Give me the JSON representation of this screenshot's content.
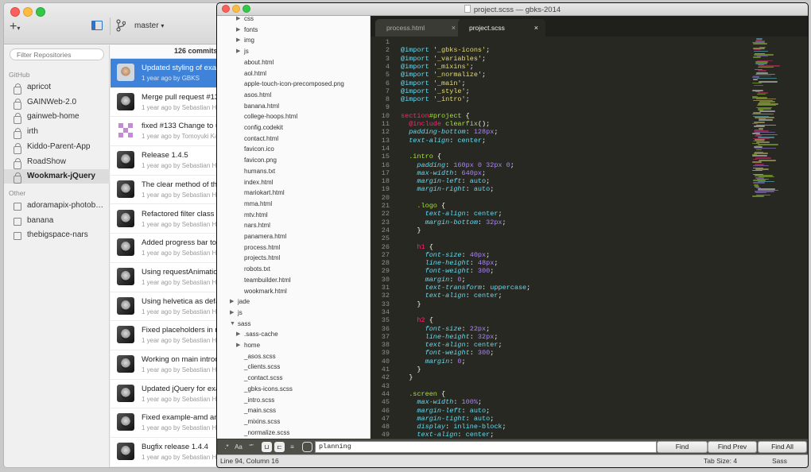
{
  "github": {
    "add_label": "+",
    "branch": "master",
    "filter_placeholder": "Filter Repositories",
    "commit_count": "126 commits",
    "sections": [
      {
        "label": "GitHub",
        "repos": [
          "apricot",
          "GAINWeb-2.0",
          "gainweb-home",
          "irth",
          "Kiddo-Parent-App",
          "RoadShow",
          "Wookmark-jQuery"
        ]
      },
      {
        "label": "Other",
        "repos": [
          "adoramapix-photob…",
          "banana",
          "thebigspace-nars"
        ]
      }
    ],
    "selected_repo": "Wookmark-jQuery",
    "commits": [
      {
        "title": "Updated styling of examp",
        "meta": "1 year ago by GBKS",
        "selected": true,
        "avatar": "photo"
      },
      {
        "title": "Merge pull request #134",
        "meta": "1 year ago by Sebastian Helz",
        "avatar": "bw"
      },
      {
        "title": "fixed #133 Change to us",
        "meta": "1 year ago by Tomoyuki Kaku",
        "avatar": "pix"
      },
      {
        "title": "Release 1.4.5",
        "meta": "1 year ago by Sebastian Helz",
        "avatar": "bw"
      },
      {
        "title": "The clear method of the",
        "meta": "1 year ago by Sebastian Helz",
        "avatar": "bw"
      },
      {
        "title": "Refactored filter class ha",
        "meta": "1 year ago by Sebastian Helz",
        "avatar": "bw"
      },
      {
        "title": "Added progress bar to in",
        "meta": "1 year ago by Sebastian Helz",
        "avatar": "bw"
      },
      {
        "title": "Using requestAnimationF",
        "meta": "1 year ago by Sebastian Helz",
        "avatar": "bw"
      },
      {
        "title": "Using helvetica as defau",
        "meta": "1 year ago by Sebastian Helz",
        "avatar": "bw"
      },
      {
        "title": "Fixed placeholders in no",
        "meta": "1 year ago by Sebastian Helz",
        "avatar": "bw"
      },
      {
        "title": "Working on main introdu",
        "meta": "1 year ago by Sebastian Helz",
        "avatar": "bw"
      },
      {
        "title": "Updated jQuery for exam",
        "meta": "1 year ago by Sebastian Helz",
        "avatar": "bw"
      },
      {
        "title": "Fixed example-amd and",
        "meta": "1 year ago by Sebastian Helz",
        "avatar": "bw"
      },
      {
        "title": "Bugfix release 1.4.4",
        "meta": "1 year ago by Sebastian Helz",
        "avatar": "bw"
      }
    ]
  },
  "sublime": {
    "title": "project.scss — gbks-2014",
    "tabs": [
      {
        "label": "process.html",
        "close": "×"
      },
      {
        "label": "project.scss",
        "close": "×"
      }
    ],
    "tree": [
      {
        "label": "css",
        "level": 1,
        "folder": true,
        "open": false
      },
      {
        "label": "fonts",
        "level": 1,
        "folder": true,
        "open": false
      },
      {
        "label": "img",
        "level": 1,
        "folder": true,
        "open": false
      },
      {
        "label": "js",
        "level": 1,
        "folder": true,
        "open": false
      },
      {
        "label": "about.html",
        "level": 1
      },
      {
        "label": "aol.html",
        "level": 1
      },
      {
        "label": "apple-touch-icon-precomposed.png",
        "level": 1
      },
      {
        "label": "asos.html",
        "level": 1
      },
      {
        "label": "banana.html",
        "level": 1
      },
      {
        "label": "college-hoops.html",
        "level": 1
      },
      {
        "label": "config.codekit",
        "level": 1
      },
      {
        "label": "contact.html",
        "level": 1
      },
      {
        "label": "favicon.ico",
        "level": 1
      },
      {
        "label": "favicon.png",
        "level": 1
      },
      {
        "label": "humans.txt",
        "level": 1
      },
      {
        "label": "index.html",
        "level": 1
      },
      {
        "label": "mariokart.html",
        "level": 1
      },
      {
        "label": "mma.html",
        "level": 1
      },
      {
        "label": "mtv.html",
        "level": 1
      },
      {
        "label": "nars.html",
        "level": 1
      },
      {
        "label": "panamera.html",
        "level": 1
      },
      {
        "label": "process.html",
        "level": 1
      },
      {
        "label": "projects.html",
        "level": 1
      },
      {
        "label": "robots.txt",
        "level": 1
      },
      {
        "label": "teambuilder.html",
        "level": 1
      },
      {
        "label": "wookmark.html",
        "level": 1
      },
      {
        "label": "jade",
        "level": 0,
        "folder": true,
        "open": false
      },
      {
        "label": "js",
        "level": 0,
        "folder": true,
        "open": false
      },
      {
        "label": "sass",
        "level": 0,
        "folder": true,
        "open": true
      },
      {
        "label": ".sass-cache",
        "level": 1,
        "folder": true,
        "open": false
      },
      {
        "label": "home",
        "level": 1,
        "folder": true,
        "open": false
      },
      {
        "label": "_asos.scss",
        "level": 1
      },
      {
        "label": "_clients.scss",
        "level": 1
      },
      {
        "label": "_contact.scss",
        "level": 1
      },
      {
        "label": "_gbks-icons.scss",
        "level": 1
      },
      {
        "label": "_intro.scss",
        "level": 1
      },
      {
        "label": "_main.scss",
        "level": 1
      },
      {
        "label": "_mixins.scss",
        "level": 1
      },
      {
        "label": "_normalize.scss",
        "level": 1
      }
    ],
    "code": [
      [],
      [
        [
          "kw",
          "@import "
        ],
        [
          "s",
          "'_gbks-icons'"
        ],
        [
          "",
          "; "
        ]
      ],
      [
        [
          "kw",
          "@import "
        ],
        [
          "s",
          "'_variables'"
        ],
        [
          "",
          ";"
        ]
      ],
      [
        [
          "kw",
          "@import "
        ],
        [
          "s",
          "'_mixins'"
        ],
        [
          "",
          ";"
        ]
      ],
      [
        [
          "kw",
          "@import "
        ],
        [
          "s",
          "'_normalize'"
        ],
        [
          "",
          ";"
        ]
      ],
      [
        [
          "kw",
          "@import "
        ],
        [
          "s",
          "'_main'"
        ],
        [
          "",
          ";"
        ]
      ],
      [
        [
          "kw",
          "@import "
        ],
        [
          "s",
          "'_style'"
        ],
        [
          "",
          ";"
        ]
      ],
      [
        [
          "kw",
          "@import "
        ],
        [
          "s",
          "'_intro'"
        ],
        [
          "",
          ";"
        ]
      ],
      [],
      [
        [
          "k",
          "section"
        ],
        [
          "f",
          "#project"
        ],
        [
          "",
          " {"
        ]
      ],
      [
        [
          "",
          "  "
        ],
        [
          "k",
          "@include "
        ],
        [
          "f",
          "clearfix"
        ],
        [
          "",
          "();"
        ]
      ],
      [
        [
          "",
          "  "
        ],
        [
          "p",
          "padding-bottom"
        ],
        [
          "",
          ": "
        ],
        [
          "n",
          "128px"
        ],
        [
          "",
          ";"
        ]
      ],
      [
        [
          "",
          "  "
        ],
        [
          "p",
          "text-align"
        ],
        [
          "",
          ": "
        ],
        [
          "kw",
          "center"
        ],
        [
          "",
          ";"
        ]
      ],
      [],
      [
        [
          "",
          "  "
        ],
        [
          "f",
          ".intro"
        ],
        [
          "",
          " {"
        ]
      ],
      [
        [
          "",
          "    "
        ],
        [
          "p",
          "padding"
        ],
        [
          "",
          ": "
        ],
        [
          "n",
          "160px 0 32px 0"
        ],
        [
          "",
          ";"
        ]
      ],
      [
        [
          "",
          "    "
        ],
        [
          "p",
          "max-width"
        ],
        [
          "",
          ": "
        ],
        [
          "n",
          "640px"
        ],
        [
          "",
          ";"
        ]
      ],
      [
        [
          "",
          "    "
        ],
        [
          "p",
          "margin-left"
        ],
        [
          "",
          ": "
        ],
        [
          "kw",
          "auto"
        ],
        [
          "",
          ";"
        ]
      ],
      [
        [
          "",
          "    "
        ],
        [
          "p",
          "margin-right"
        ],
        [
          "",
          ": "
        ],
        [
          "kw",
          "auto"
        ],
        [
          "",
          ";"
        ]
      ],
      [],
      [
        [
          "",
          "    "
        ],
        [
          "f",
          ".logo"
        ],
        [
          "",
          " {"
        ]
      ],
      [
        [
          "",
          "      "
        ],
        [
          "p",
          "text-align"
        ],
        [
          "",
          ": "
        ],
        [
          "kw",
          "center"
        ],
        [
          "",
          ";"
        ]
      ],
      [
        [
          "",
          "      "
        ],
        [
          "p",
          "margin-bottom"
        ],
        [
          "",
          ": "
        ],
        [
          "n",
          "32px"
        ],
        [
          "",
          ";"
        ]
      ],
      [
        [
          "",
          "    }"
        ]
      ],
      [],
      [
        [
          "",
          "    "
        ],
        [
          "k",
          "h1"
        ],
        [
          "",
          " {"
        ]
      ],
      [
        [
          "",
          "      "
        ],
        [
          "p",
          "font-size"
        ],
        [
          "",
          ": "
        ],
        [
          "n",
          "40px"
        ],
        [
          "",
          ";"
        ]
      ],
      [
        [
          "",
          "      "
        ],
        [
          "p",
          "line-height"
        ],
        [
          "",
          ": "
        ],
        [
          "n",
          "48px"
        ],
        [
          "",
          ";"
        ]
      ],
      [
        [
          "",
          "      "
        ],
        [
          "p",
          "font-weight"
        ],
        [
          "",
          ": "
        ],
        [
          "n",
          "300"
        ],
        [
          "",
          ";"
        ]
      ],
      [
        [
          "",
          "      "
        ],
        [
          "p",
          "margin"
        ],
        [
          "",
          ": "
        ],
        [
          "n",
          "0"
        ],
        [
          "",
          ";"
        ]
      ],
      [
        [
          "",
          "      "
        ],
        [
          "p",
          "text-transform"
        ],
        [
          "",
          ": "
        ],
        [
          "kw",
          "uppercase"
        ],
        [
          "",
          ";"
        ]
      ],
      [
        [
          "",
          "      "
        ],
        [
          "p",
          "text-align"
        ],
        [
          "",
          ": "
        ],
        [
          "kw",
          "center"
        ],
        [
          "",
          ";"
        ]
      ],
      [
        [
          "",
          "    }"
        ]
      ],
      [],
      [
        [
          "",
          "    "
        ],
        [
          "k",
          "h2"
        ],
        [
          "",
          " {"
        ]
      ],
      [
        [
          "",
          "      "
        ],
        [
          "p",
          "font-size"
        ],
        [
          "",
          ": "
        ],
        [
          "n",
          "22px"
        ],
        [
          "",
          ";"
        ]
      ],
      [
        [
          "",
          "      "
        ],
        [
          "p",
          "line-height"
        ],
        [
          "",
          ": "
        ],
        [
          "n",
          "32px"
        ],
        [
          "",
          ";"
        ]
      ],
      [
        [
          "",
          "      "
        ],
        [
          "p",
          "text-align"
        ],
        [
          "",
          ": "
        ],
        [
          "kw",
          "center"
        ],
        [
          "",
          ";"
        ]
      ],
      [
        [
          "",
          "      "
        ],
        [
          "p",
          "font-weight"
        ],
        [
          "",
          ": "
        ],
        [
          "n",
          "300"
        ],
        [
          "",
          ";"
        ]
      ],
      [
        [
          "",
          "      "
        ],
        [
          "p",
          "margin"
        ],
        [
          "",
          ": "
        ],
        [
          "n",
          "0"
        ],
        [
          "",
          ";"
        ]
      ],
      [
        [
          "",
          "    }"
        ]
      ],
      [
        [
          "",
          "  }"
        ]
      ],
      [],
      [
        [
          "",
          "  "
        ],
        [
          "f",
          ".screen"
        ],
        [
          "",
          " {"
        ]
      ],
      [
        [
          "",
          "    "
        ],
        [
          "p",
          "max-width"
        ],
        [
          "",
          ": "
        ],
        [
          "n",
          "100%"
        ],
        [
          "",
          ";"
        ]
      ],
      [
        [
          "",
          "    "
        ],
        [
          "p",
          "margin-left"
        ],
        [
          "",
          ": "
        ],
        [
          "kw",
          "auto"
        ],
        [
          "",
          ";"
        ]
      ],
      [
        [
          "",
          "    "
        ],
        [
          "p",
          "margin-tight"
        ],
        [
          "",
          ": "
        ],
        [
          "kw",
          "auto"
        ],
        [
          "",
          ";"
        ]
      ],
      [
        [
          "",
          "    "
        ],
        [
          "p",
          "display"
        ],
        [
          "",
          ": "
        ],
        [
          "kw",
          "inline-block"
        ],
        [
          "",
          ";"
        ]
      ],
      [
        [
          "",
          "    "
        ],
        [
          "p",
          "text-align"
        ],
        [
          "",
          ": "
        ],
        [
          "kw",
          "center"
        ],
        [
          "",
          ";"
        ]
      ],
      [
        [
          "",
          "    "
        ],
        [
          "p",
          "background-color"
        ],
        [
          "",
          ": "
        ],
        [
          "n",
          "#dedede"
        ],
        [
          "",
          ";"
        ]
      ]
    ],
    "find": {
      "toggles": [
        ".*",
        "Aa",
        "“”"
      ],
      "query": "planning",
      "find_label": "Find",
      "find_prev_label": "Find Prev",
      "find_all_label": "Find All"
    },
    "status": {
      "position": "Line 94, Column 16",
      "tab_size": "Tab Size: 4",
      "syntax": "Sass"
    }
  },
  "colors": {
    "selection_blue": "#3e82d9",
    "editor_bg": "#272822"
  }
}
